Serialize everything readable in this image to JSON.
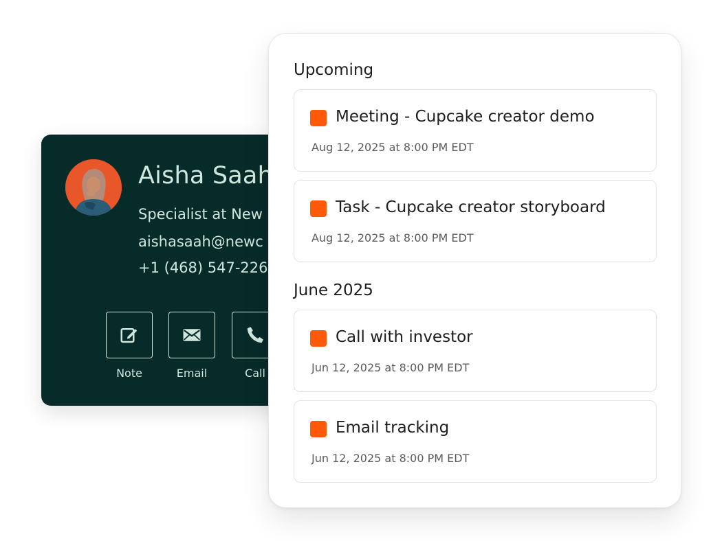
{
  "contact": {
    "name": "Aisha Saah",
    "title": "Specialist at New",
    "email": "aishasaah@newc",
    "phone": "+1 (468) 547-226",
    "actions": [
      {
        "label": "Note",
        "icon": "edit-icon"
      },
      {
        "label": "Email",
        "icon": "mail-icon"
      },
      {
        "label": "Call",
        "icon": "phone-icon"
      }
    ]
  },
  "activity": {
    "sections": [
      {
        "heading": "Upcoming",
        "items": [
          {
            "title": "Meeting - Cupcake creator demo",
            "date": "Aug 12, 2025 at 8:00 PM EDT"
          },
          {
            "title": "Task - Cupcake creator storyboard",
            "date": "Aug 12, 2025 at 8:00 PM EDT"
          }
        ]
      },
      {
        "heading": "June 2025",
        "items": [
          {
            "title": "Call with investor",
            "date": "Jun 12, 2025 at 8:00 PM EDT"
          },
          {
            "title": "Email tracking",
            "date": "Jun 12, 2025 at 8:00 PM EDT"
          }
        ]
      }
    ]
  },
  "colors": {
    "card_bg": "#072b29",
    "card_text": "#cfe7dd",
    "accent": "#ff5a0a",
    "avatar_bg": "#e8562a"
  }
}
